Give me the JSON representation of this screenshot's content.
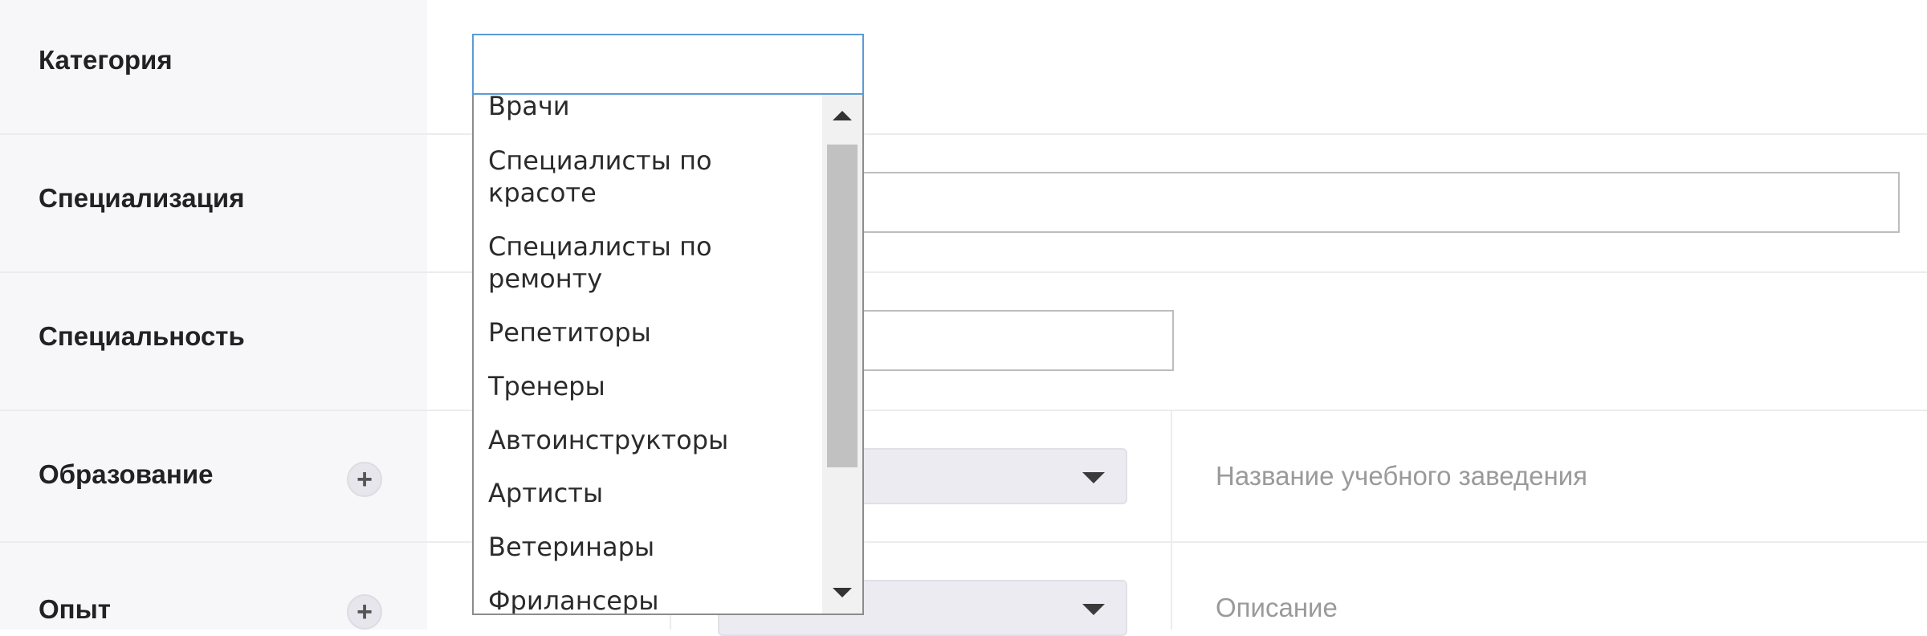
{
  "form": {
    "rows": [
      {
        "label": "Категория"
      },
      {
        "label": "Специализация"
      },
      {
        "label": "Специальность"
      },
      {
        "label": "Образование",
        "add_icon": "plus-icon",
        "placeholder": "Название учебного заведения"
      },
      {
        "label": "Опыт",
        "add_icon": "plus-icon",
        "placeholder": "Описание"
      }
    ]
  },
  "dropdown": {
    "search_value": "",
    "options": [
      "Врачи",
      "Специалисты по красоте",
      "Специалисты по ремонту",
      "Репетиторы",
      "Тренеры",
      "Автоинструкторы",
      "Артисты",
      "Ветеринары",
      "Фрилансеры"
    ],
    "scroll_up_icon": "triangle-up-icon",
    "scroll_down_icon": "triangle-down-icon"
  },
  "colors": {
    "focus_border": "#5b9bd5",
    "label_bg": "#f7f7f9",
    "select_bg": "#ebebf1"
  }
}
